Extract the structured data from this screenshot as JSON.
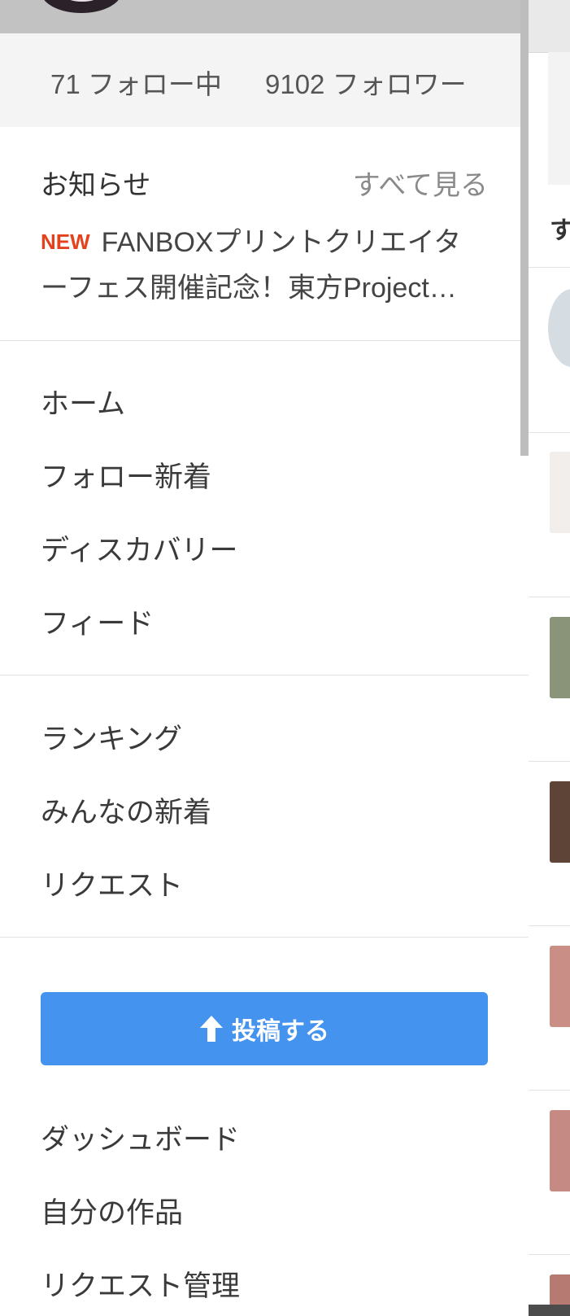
{
  "profile": {
    "following_count": "71",
    "following_label": "フォロー中",
    "follower_count": "9102",
    "follower_label": "フォロワー"
  },
  "notice": {
    "title": "お知らせ",
    "see_all": "すべて見る",
    "badge": "NEW",
    "text": "FANBOXプリントクリエイターフェス開催記念！東方Project…"
  },
  "menu_group1": [
    "ホーム",
    "フォロー新着",
    "ディスカバリー",
    "フィード"
  ],
  "menu_group2": [
    "ランキング",
    "みんなの新着",
    "リクエスト"
  ],
  "post_button": {
    "label": "投稿する",
    "icon": "arrow-up-icon",
    "color": "#4393ef"
  },
  "menu_group3": [
    "ダッシュボード",
    "自分の作品",
    "リクエスト管理"
  ],
  "background_page": {
    "heading_fragment": "す"
  },
  "colors": {
    "new_badge": "#e4411d",
    "accent": "#4393ef"
  }
}
